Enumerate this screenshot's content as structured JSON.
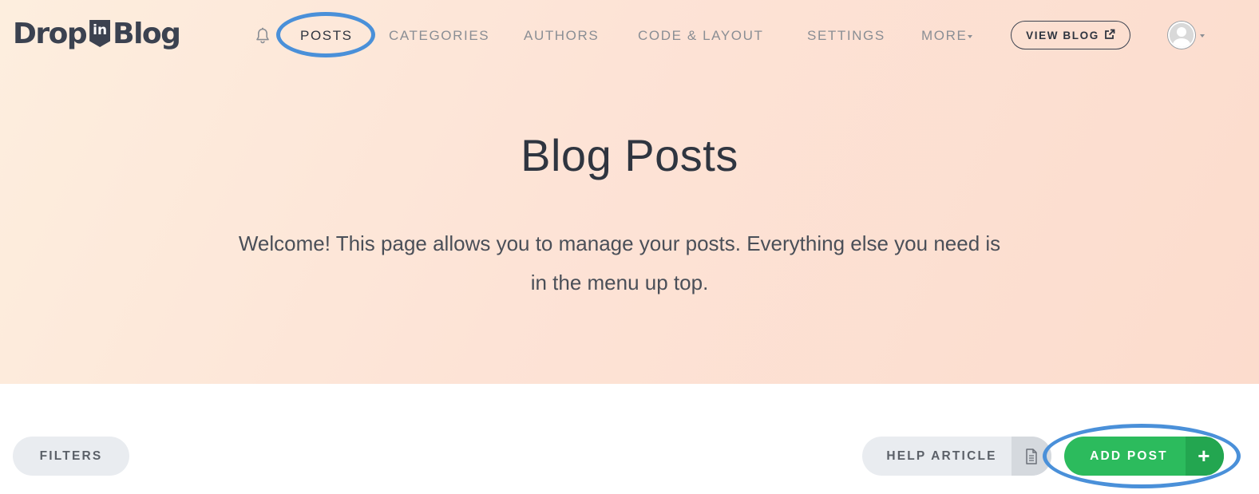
{
  "header": {
    "logo": {
      "part1": "Drop",
      "badge": "in",
      "part2": "Blog"
    },
    "nav": {
      "posts": "POSTS",
      "categories": "CATEGORIES",
      "authors": "AUTHORS",
      "code_layout": "CODE & LAYOUT",
      "settings": "SETTINGS",
      "more": "MORE"
    },
    "view_blog": "VIEW BLOG"
  },
  "hero": {
    "title": "Blog Posts",
    "intro": "Welcome! This page allows you to manage your posts. Everything else you need is in the menu up top."
  },
  "toolbar": {
    "filters": "FILTERS",
    "help_article": "HELP ARTICLE",
    "add_post": "ADD POST",
    "add_post_icon_text": "+"
  },
  "icons": {
    "notifications": "bell-icon",
    "external_link": "external-link-icon",
    "document": "document-icon",
    "plus": "plus-icon"
  },
  "colors": {
    "accent_annotation": "#4a90d9",
    "add_button": "#2cbb5d",
    "text_dark": "#2f3540",
    "nav_muted": "#8a8e94"
  }
}
